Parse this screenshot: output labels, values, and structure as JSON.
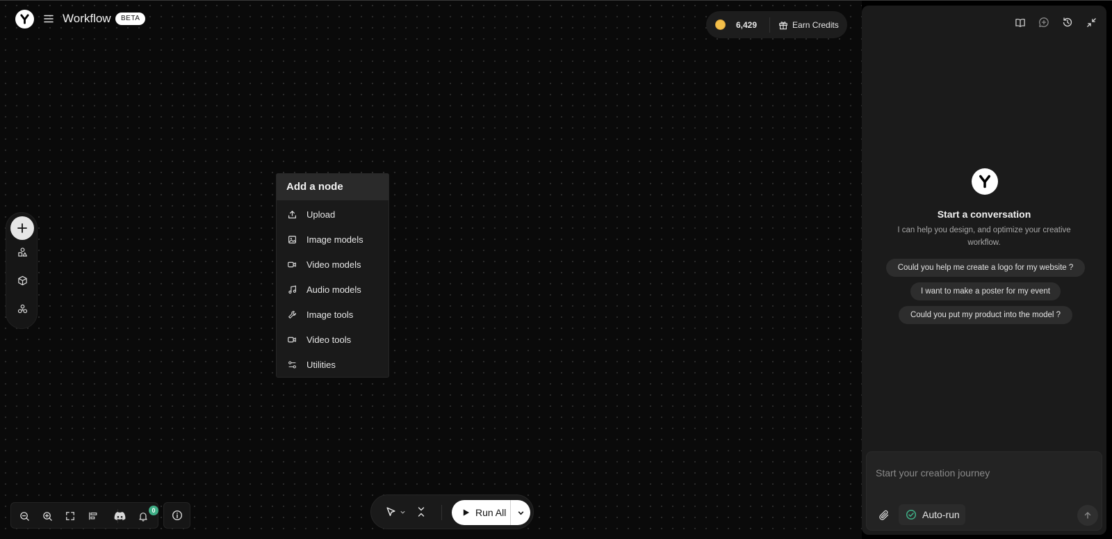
{
  "header": {
    "app_title": "Workflow",
    "badge": "BETA",
    "credits": "6,429",
    "earn_credits": "Earn Credits"
  },
  "node_menu": {
    "title": "Add a node",
    "items": [
      {
        "label": "Upload",
        "icon": "upload-icon"
      },
      {
        "label": "Image models",
        "icon": "image-icon"
      },
      {
        "label": "Video models",
        "icon": "video-camera-icon"
      },
      {
        "label": "Audio models",
        "icon": "music-note-icon"
      },
      {
        "label": "Image tools",
        "icon": "wrench-icon"
      },
      {
        "label": "Video tools",
        "icon": "video-camera-icon"
      },
      {
        "label": "Utilities",
        "icon": "utilities-icon"
      }
    ]
  },
  "bottom_bar": {
    "notification_count": "0",
    "run_all": "Run All"
  },
  "chat": {
    "title": "Start a conversation",
    "subtitle": "I can help you design, and optimize your creative workflow.",
    "suggestions": [
      "Could you help me create a logo for my website ?",
      "I want to make a poster for my event",
      "Could you put my product into the model ?"
    ],
    "input_placeholder": "Start your creation journey",
    "auto_run": "Auto-run"
  },
  "colors": {
    "background": "#0a0a0a",
    "panel": "#1b1b1b",
    "coin": "#f3bf4a",
    "badge_green": "#3fae86",
    "autorun_check": "#3fae86"
  }
}
